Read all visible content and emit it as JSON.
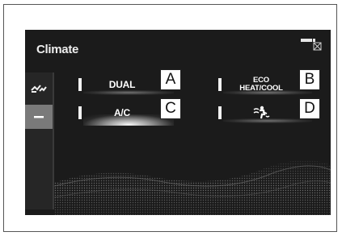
{
  "screen": {
    "title": "Climate"
  },
  "sidebar": {
    "items": [
      {
        "icon": "airflow-icon",
        "active": false
      },
      {
        "icon": "minus-icon",
        "active": true
      }
    ]
  },
  "controls": [
    {
      "label": "DUAL",
      "callout": "A",
      "active": false
    },
    {
      "label_line1": "ECO",
      "label_line2": "HEAT/COOL",
      "callout": "B",
      "active": false
    },
    {
      "label": "A/C",
      "callout": "C",
      "active": true
    },
    {
      "icon": "air-intake-icon",
      "callout": "D",
      "active": false
    }
  ],
  "colors": {
    "screen_bg": "#1b1b1b",
    "text": "#ffffff",
    "sidebar_active": "#7a7a7a"
  }
}
